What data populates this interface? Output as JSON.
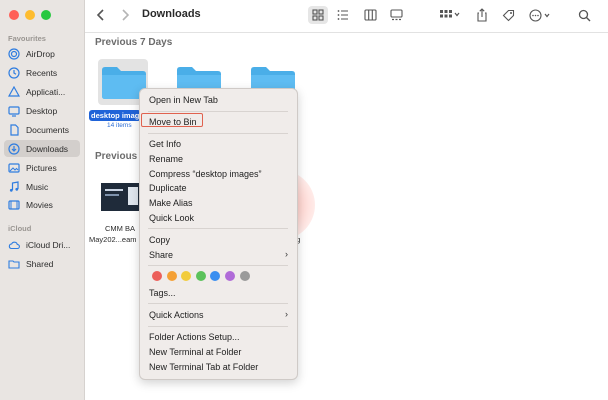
{
  "window": {
    "title": "Downloads"
  },
  "sidebar": {
    "favourites_label": "Favourites",
    "icloud_label": "iCloud",
    "favourites": [
      {
        "label": "AirDrop",
        "icon": "airdrop-icon"
      },
      {
        "label": "Recents",
        "icon": "clock-icon"
      },
      {
        "label": "Applicati...",
        "icon": "applications-icon"
      },
      {
        "label": "Desktop",
        "icon": "desktop-icon"
      },
      {
        "label": "Documents",
        "icon": "document-icon"
      },
      {
        "label": "Downloads",
        "icon": "download-icon",
        "active": true
      },
      {
        "label": "Pictures",
        "icon": "pictures-icon"
      },
      {
        "label": "Music",
        "icon": "music-icon"
      },
      {
        "label": "Movies",
        "icon": "movies-icon"
      }
    ],
    "icloud": [
      {
        "label": "iCloud Dri...",
        "icon": "icloud-drive-icon"
      },
      {
        "label": "Shared",
        "icon": "shared-folder-icon"
      }
    ]
  },
  "content": {
    "section1": "Previous 7 Days",
    "section2": "Previous",
    "selected_folder": {
      "name": "desktop imag",
      "count": "14 items"
    },
    "file1": {
      "line1": "CMM BA",
      "line2": "May202...eam"
    },
    "file2": {
      "line1": "a-",
      "line2": "pg"
    }
  },
  "context_menu": {
    "open_new_tab": "Open in New Tab",
    "move_to_bin": "Move to Bin",
    "get_info": "Get Info",
    "rename": "Rename",
    "compress": "Compress “desktop images”",
    "duplicate": "Duplicate",
    "make_alias": "Make Alias",
    "quick_look": "Quick Look",
    "copy": "Copy",
    "share": "Share",
    "tags": "Tags...",
    "quick_actions": "Quick Actions",
    "folder_actions_setup": "Folder Actions Setup...",
    "new_terminal": "New Terminal at Folder",
    "new_terminal_tab": "New Terminal Tab at Folder",
    "tag_colors": [
      "#ec5f5a",
      "#f4a035",
      "#f2cc3c",
      "#5bc25b",
      "#3a8ef0",
      "#b06bd8",
      "#9a9a9a"
    ]
  },
  "colors": {
    "accent": "#1f63d8",
    "highlight_border": "#e0624f",
    "sidebar_bg": "#e9e5e2"
  }
}
